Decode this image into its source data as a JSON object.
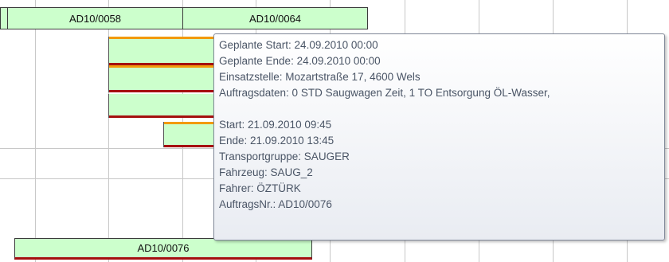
{
  "gantt": {
    "top_tasks": [
      {
        "label": "AD10/0058"
      },
      {
        "label": "AD10/0064"
      }
    ],
    "bottom_task": {
      "label": "AD10/0076"
    }
  },
  "tooltip": {
    "lines_1": [
      "Geplante Start: 24.09.2010 00:00",
      "Geplante Ende: 24.09.2010 00:00",
      "Einsatzstelle: Mozartstraße 17, 4600 Wels",
      "Auftragsdaten: 0 STD Saugwagen Zeit, 1 TO Entsorgung ÖL-Wasser,"
    ],
    "lines_2": [
      "Start: 21.09.2010 09:45",
      "Ende: 21.09.2010 13:45",
      "Transportgruppe: SAUGER",
      "Fahrzeug: SAUG_2",
      "Fahrer: ÖZTÜRK",
      "AuftragsNr.: AD10/0076"
    ]
  },
  "colors": {
    "task_fill": "#ccffcc",
    "bar_top": "#f29a0d",
    "bar_bottom": "#a50f0f",
    "grid": "#c8c8c8"
  }
}
